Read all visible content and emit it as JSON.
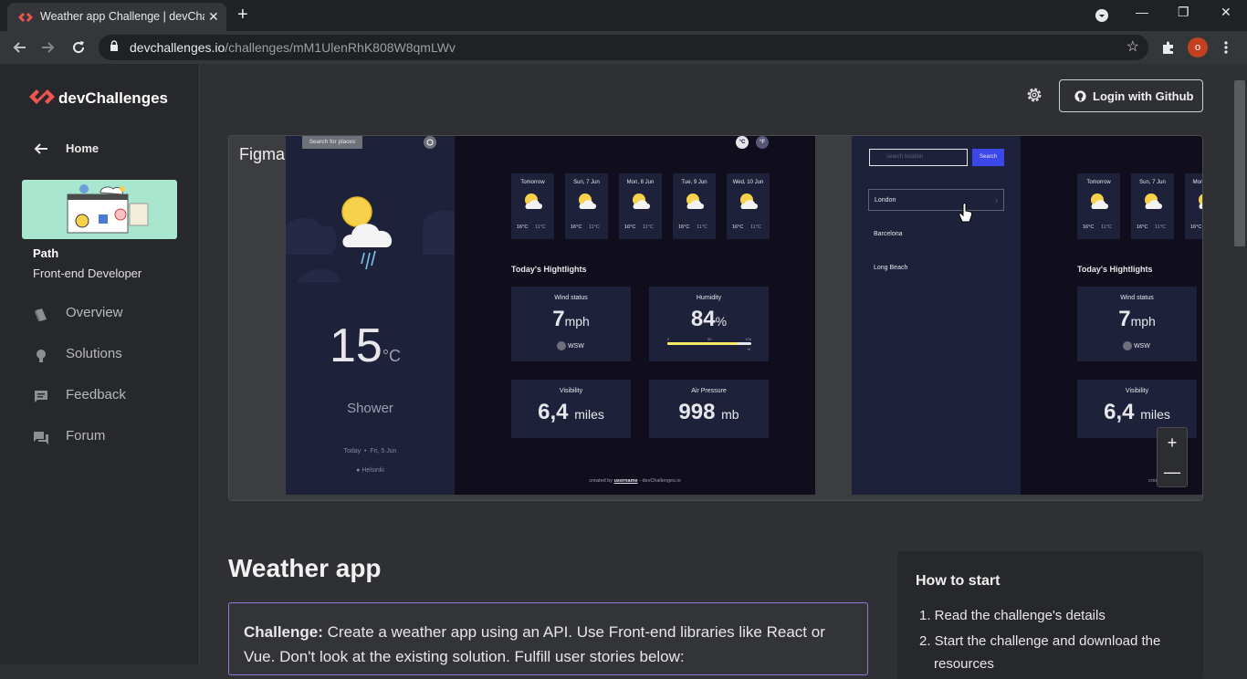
{
  "browser": {
    "tab_title": "Weather app Challenge | devChallenges",
    "tab_close": "✕",
    "new_tab": "+",
    "minimize": "—",
    "restore": "❐",
    "close": "✕",
    "url_domain": "devchallenges.io",
    "url_path": "/challenges/mM1UlenRhK808W8qmLWv",
    "profile_initial": "o"
  },
  "sidebar": {
    "brand": "devChallenges",
    "home": "Home",
    "path_heading": "Path",
    "path_value": "Front-end Developer",
    "items": [
      {
        "label": "Overview",
        "icon": "book-icon"
      },
      {
        "label": "Solutions",
        "icon": "lightbulb-icon"
      },
      {
        "label": "Feedback",
        "icon": "feedback-icon"
      },
      {
        "label": "Forum",
        "icon": "forum-icon"
      }
    ]
  },
  "header": {
    "login": "Login with Github"
  },
  "figma": {
    "label": "Figma",
    "zoom_in": "+",
    "zoom_out": "—",
    "design": {
      "search_btn": "Search for places",
      "unit_c": "°C",
      "unit_f": "°F",
      "temp": "15",
      "temp_unit": "°C",
      "condition": "Shower",
      "today": "Today",
      "dot": "•",
      "date": "Fri, 5 Jun",
      "location": "Helsinki",
      "forecast": [
        {
          "day": "Tomorrow",
          "max": "16°C",
          "min": "11°C"
        },
        {
          "day": "Sun, 7 Jun",
          "max": "16°C",
          "min": "11°C"
        },
        {
          "day": "Mon, 8 Jun",
          "max": "16°C",
          "min": "11°C"
        },
        {
          "day": "Tue, 9 Jun",
          "max": "16°C",
          "min": "11°C"
        },
        {
          "day": "Wed, 10 Jun",
          "max": "16°C",
          "min": "11°C"
        }
      ],
      "highlights_title": "Today's Hightlights",
      "wind_label": "Wind status",
      "wind_value": "7",
      "wind_unit": "mph",
      "wind_dir": "WSW",
      "humidity_label": "Humidity",
      "humidity_value": "84",
      "humidity_unit": "%",
      "humidity_scale": [
        "0",
        "50",
        "100"
      ],
      "humidity_pct_sign": "%",
      "humidity_level": 0.84,
      "visibility_label": "Visibility",
      "visibility_value": "6,4",
      "visibility_unit": "miles",
      "pressure_label": "Air Pressure",
      "pressure_value": "998",
      "pressure_unit": "mb",
      "footer_prefix": "created by",
      "footer_user": "username",
      "footer_suffix": "- devChallenges.io",
      "search_placeholder": "search location",
      "search_action": "Search",
      "places": [
        "London",
        "Barcelona",
        "Long Beach"
      ],
      "chevron": "›",
      "footer_cut_prefix": "crea"
    }
  },
  "content": {
    "title": "Weather app",
    "challenge_label": "Challenge:",
    "challenge_text": " Create a weather app using an API. Use Front-end libraries like React or Vue. Don't look at the existing solution. Fulfill user stories below:",
    "howto_title": "How to start",
    "howto_steps": [
      "1. Read the challenge's details",
      "2. Start the challenge and download the",
      "resources"
    ]
  }
}
